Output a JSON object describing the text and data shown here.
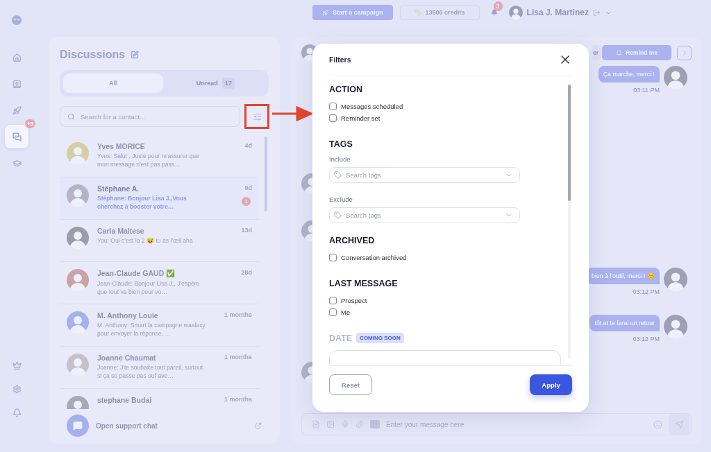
{
  "sidebar": {
    "items": [
      {
        "kind": "logo",
        "selected": false
      },
      {
        "kind": "home",
        "selected": false
      },
      {
        "kind": "contacts",
        "selected": false
      },
      {
        "kind": "campaigns",
        "selected": false
      },
      {
        "kind": "messages",
        "selected": true,
        "badge": "+5"
      },
      {
        "kind": "academy",
        "selected": false
      }
    ],
    "bottom_items": [
      {
        "kind": "premium"
      },
      {
        "kind": "settings"
      },
      {
        "kind": "notifications"
      }
    ]
  },
  "top_bar": {
    "campaign_button": "Start a campaign",
    "credits": "13500 credits",
    "notifications_badge": "3",
    "user_name": "Lisa J. Martinez"
  },
  "discussions": {
    "title": "Discussions",
    "tabs": [
      {
        "label": "All",
        "selected": true
      },
      {
        "label": "Unread",
        "count": "17",
        "selected": false
      }
    ],
    "search": {
      "placeholder": "Search for a contact..."
    },
    "contacts": [
      {
        "name": "Yves MORICE",
        "time": "4d",
        "preview": "Yves: Salut , Juste pour m'assurer que mon message n'est pas pass…",
        "unread": false
      },
      {
        "name": "Stéphane A.",
        "time": "9d",
        "preview": "Stéphane: Bonjour Lisa J.,Vous cherchez à booster votre…",
        "unread": true,
        "badge": "1"
      },
      {
        "name": "Carla Maltese",
        "time": "13d",
        "preview": "You: Oui c'est la 2 😅 tu as l'œil aha",
        "unread": false
      },
      {
        "name": "Jean-Claude GAUD ✅",
        "time": "28d",
        "preview": "Jean-Claude: Bonjour Lisa J., J'espère que tout va bien pour vo…",
        "unread": false
      },
      {
        "name": "M. Anthony Louie",
        "time": "1 months",
        "preview": "M. Anthony: Smart la campagne waalaxy pour envoyer la réponse, …",
        "unread": false
      },
      {
        "name": "Joanne Chaumat",
        "time": "1 months",
        "preview": "Joanne: J'te souhaite tout pareil, surtout si ça se passe pas ouf ave…",
        "unread": false
      },
      {
        "name": "stephane Budai",
        "time": "1 months",
        "unread": false
      }
    ],
    "support": "Open support chat"
  },
  "chat": {
    "header_button": "er",
    "remind_button": "Remind me",
    "messages": [
      {
        "kind": "outgoing",
        "text": "Ça marche, merci !",
        "time": "03:11 PM"
      },
      {
        "kind": "incoming"
      },
      {
        "kind": "incoming"
      },
      {
        "kind": "outgoing",
        "text": "bien à l'outil, merci ! 😊",
        "time": "03:12 PM"
      },
      {
        "kind": "outgoing",
        "text": "tôt et te ferai un retour",
        "time": "03:12 PM"
      },
      {
        "kind": "incoming"
      }
    ],
    "composer": {
      "placeholder": "Enter your message here"
    }
  },
  "filters_modal": {
    "title": "Filters",
    "sections": [
      {
        "kind": "checkboxes",
        "title": "ACTION",
        "options": [
          {
            "label": "Messages scheduled",
            "checked": false
          },
          {
            "label": "Reminder set",
            "checked": false
          }
        ]
      },
      {
        "kind": "tags",
        "title": "TAGS",
        "fields": [
          {
            "label": "Include",
            "placeholder": "Search tags"
          },
          {
            "label": "Exclude",
            "placeholder": "Search tags"
          }
        ]
      },
      {
        "kind": "checkboxes",
        "title": "ARCHIVED",
        "options": [
          {
            "label": "Conversation archived",
            "checked": false
          }
        ]
      },
      {
        "kind": "checkboxes",
        "title": "LAST MESSAGE",
        "options": [
          {
            "label": "Prospect",
            "checked": false
          },
          {
            "label": "Me",
            "checked": false
          }
        ]
      },
      {
        "kind": "soon",
        "title": "DATE",
        "badge": "COMING SOON"
      }
    ],
    "reset_button": "Reset",
    "apply_button": "Apply"
  }
}
